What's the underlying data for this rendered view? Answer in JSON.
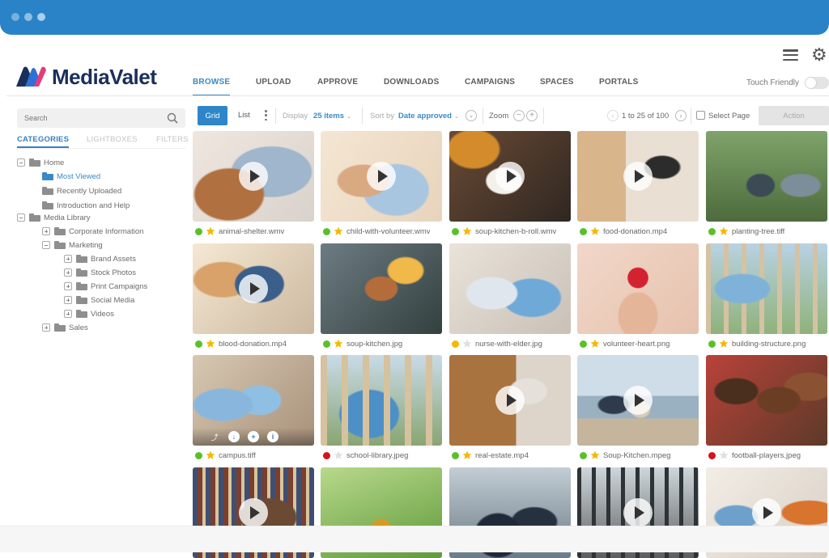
{
  "app": {
    "brand": "MediaValet",
    "colors": {
      "titlebar": "#2a83c6",
      "accent": "#3a8ac6",
      "brand_dark": "#1a2f5a",
      "logo_blue": "#2e6fd8",
      "logo_pink": "#e23d7a"
    }
  },
  "nav": {
    "items": [
      {
        "label": "BROWSE",
        "active": true
      },
      {
        "label": "UPLOAD",
        "active": false
      },
      {
        "label": "APPROVE",
        "active": false
      },
      {
        "label": "DOWNLOADS",
        "active": false
      },
      {
        "label": "CAMPAIGNS",
        "active": false
      },
      {
        "label": "SPACES",
        "active": false
      },
      {
        "label": "PORTALS",
        "active": false
      }
    ],
    "touch_friendly_label": "Touch Friendly",
    "touch_friendly_on": false
  },
  "sidebar": {
    "search_placeholder": "Search",
    "tabs": [
      {
        "label": "CATEGORIES",
        "active": true
      },
      {
        "label": "LIGHTBOXES",
        "active": false
      },
      {
        "label": "FILTERS",
        "active": false
      }
    ],
    "tree": [
      {
        "label": "Home",
        "depth": 0,
        "expander": "minus",
        "selected": false
      },
      {
        "label": "Most Viewed",
        "depth": 1,
        "expander": "none",
        "selected": true
      },
      {
        "label": "Recently Uploaded",
        "depth": 1,
        "expander": "none",
        "selected": false
      },
      {
        "label": "Introduction and Help",
        "depth": 1,
        "expander": "none",
        "selected": false
      },
      {
        "label": "Media Library",
        "depth": 0,
        "expander": "minus",
        "selected": false
      },
      {
        "label": "Corporate Information",
        "depth": 1,
        "expander": "plus",
        "selected": false
      },
      {
        "label": "Marketing",
        "depth": 1,
        "expander": "minus",
        "selected": false
      },
      {
        "label": "Brand Assets",
        "depth": 2,
        "expander": "plus",
        "selected": false
      },
      {
        "label": "Stock Photos",
        "depth": 2,
        "expander": "plus",
        "selected": false
      },
      {
        "label": "Print Campaigns",
        "depth": 2,
        "expander": "plus",
        "selected": false
      },
      {
        "label": "Social Media",
        "depth": 2,
        "expander": "plus",
        "selected": false
      },
      {
        "label": "Videos",
        "depth": 2,
        "expander": "plus",
        "selected": false
      },
      {
        "label": "Sales",
        "depth": 1,
        "expander": "plus",
        "selected": false
      }
    ]
  },
  "toolbar": {
    "grid_label": "Grid",
    "list_label": "List",
    "display_label": "Display",
    "display_value": "25 items",
    "sort_label": "Sort by",
    "sort_value": "Date approved",
    "zoom_label": "Zoom",
    "pager_text": "1 to 25 of 100",
    "select_page_label": "Select Page",
    "action_label": "Action"
  },
  "assets": [
    {
      "name": "animal-shelter.wmv",
      "status": "green",
      "starred": true,
      "video": true,
      "scene": "dog"
    },
    {
      "name": "child-with-volunteer.wmv",
      "status": "green",
      "starred": true,
      "video": true,
      "scene": "hug"
    },
    {
      "name": "soup-kitchen-b-roll.wmv",
      "status": "green",
      "starred": true,
      "video": true,
      "scene": "bowl"
    },
    {
      "name": "food-donation.mp4",
      "status": "green",
      "starred": true,
      "video": true,
      "scene": "boxes"
    },
    {
      "name": "planting-tree.tiff",
      "status": "green",
      "starred": true,
      "video": false,
      "scene": "hike"
    },
    {
      "name": "blood-donation.mp4",
      "status": "green",
      "starred": true,
      "video": true,
      "scene": "blood"
    },
    {
      "name": "soup-kitchen.jpg",
      "status": "green",
      "starred": true,
      "video": false,
      "scene": "kitchen"
    },
    {
      "name": "nurse-with-elder.jpg",
      "status": "yellow",
      "starred": false,
      "video": false,
      "scene": "nurse"
    },
    {
      "name": "volunteer-heart.png",
      "status": "green",
      "starred": true,
      "video": false,
      "scene": "heart"
    },
    {
      "name": "building-structure.png",
      "status": "green",
      "starred": true,
      "video": false,
      "scene": "build"
    },
    {
      "name": "campus.tiff",
      "status": "green",
      "starred": true,
      "video": false,
      "scene": "campus",
      "hover": true
    },
    {
      "name": "school-library.jpeg",
      "status": "red",
      "starred": false,
      "video": false,
      "scene": "school"
    },
    {
      "name": "real-estate.mp4",
      "status": "green",
      "starred": true,
      "video": true,
      "scene": "move"
    },
    {
      "name": "Soup-Kitchen.mpeg",
      "status": "green",
      "starred": true,
      "video": true,
      "scene": "beach"
    },
    {
      "name": "football-players.jpeg",
      "status": "red",
      "starred": false,
      "video": false,
      "scene": "kids"
    },
    {
      "name": "",
      "status": "",
      "starred": false,
      "video": true,
      "scene": "library"
    },
    {
      "name": "",
      "status": "",
      "starred": false,
      "video": false,
      "scene": "grass"
    },
    {
      "name": "",
      "status": "",
      "starred": false,
      "video": false,
      "scene": "grad"
    },
    {
      "name": "",
      "status": "",
      "starred": false,
      "video": true,
      "scene": "office"
    },
    {
      "name": "",
      "status": "",
      "starred": false,
      "video": true,
      "scene": "meeting"
    }
  ],
  "hover_actions": [
    "share-icon",
    "cloud-download-icon",
    "add-icon",
    "info-icon",
    "embed-icon"
  ],
  "status_colors": {
    "green": "#5cbf2a",
    "yellow": "#f5b800",
    "red": "#d9101e"
  }
}
